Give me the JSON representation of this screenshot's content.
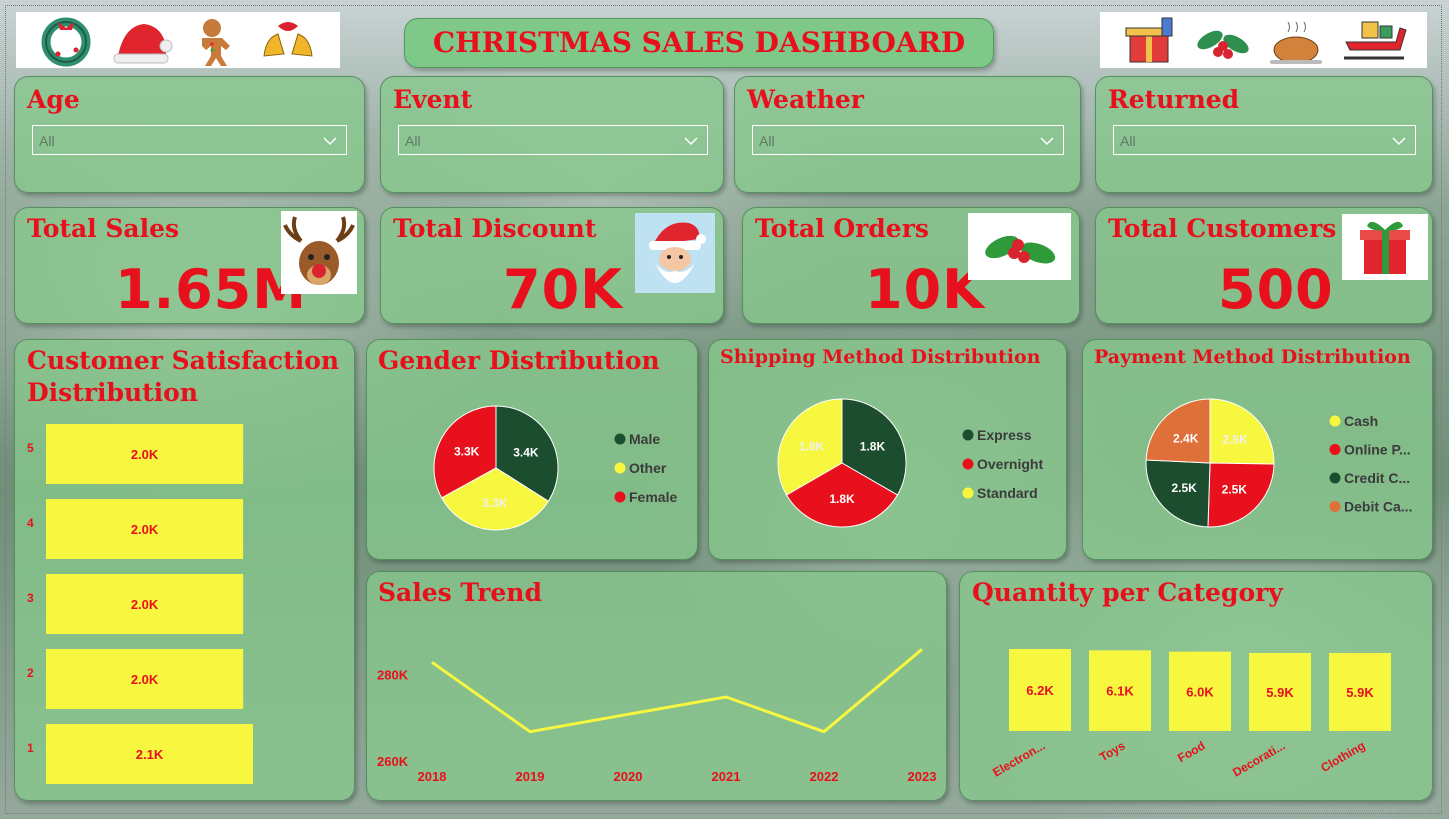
{
  "header": {
    "title": "CHRISTMAS SALES DASHBOARD"
  },
  "icons_left": [
    "wreath-icon",
    "santa-hat-icon",
    "gingerbread-icon",
    "bells-icon"
  ],
  "icons_right": [
    "gift-icon",
    "holly-icon",
    "roast-turkey-icon",
    "sleigh-icon"
  ],
  "filters": [
    {
      "label": "Age",
      "value": "All"
    },
    {
      "label": "Event",
      "value": "All"
    },
    {
      "label": "Weather",
      "value": "All"
    },
    {
      "label": "Returned",
      "value": "All"
    }
  ],
  "kpis": [
    {
      "label": "Total Sales",
      "value": "1.65M",
      "icon": "reindeer-icon"
    },
    {
      "label": "Total Discount",
      "value": "70K",
      "icon": "santa-icon"
    },
    {
      "label": "Total Orders",
      "value": "10K",
      "icon": "holly-icon"
    },
    {
      "label": "Total Customers",
      "value": "500",
      "icon": "gift-icon"
    }
  ],
  "colors": {
    "red": "#e8101c",
    "green": "#1b4d2e",
    "yellow": "#f7f740",
    "orange": "#e0703a",
    "card": "#87c88c"
  },
  "satisfaction": {
    "title_line1": "Customer Satisfaction",
    "title_line2": "Distribution"
  },
  "gender": {
    "title": "Gender Distribution"
  },
  "shipping": {
    "title": "Shipping Method Distribution"
  },
  "payment": {
    "title": "Payment Method Distribution"
  },
  "trend": {
    "title": "Sales Trend"
  },
  "category": {
    "title": "Quantity per Category"
  },
  "chart_data": [
    {
      "type": "bar",
      "orientation": "horizontal",
      "categories": [
        "5",
        "4",
        "3",
        "2",
        "1"
      ],
      "values": [
        2.0,
        2.0,
        2.0,
        2.0,
        2.1
      ],
      "labels": [
        "2.0K",
        "2.0K",
        "2.0K",
        "2.0K",
        "2.1K"
      ],
      "title": "Customer Satisfaction Distribution",
      "color": "#f7f740"
    },
    {
      "type": "pie",
      "title": "Gender Distribution",
      "series": [
        {
          "name": "Male",
          "value": 3.4,
          "label": "3.4K",
          "color": "#1b4d2e"
        },
        {
          "name": "Other",
          "value": 3.3,
          "label": "3.3K",
          "color": "#f7f740"
        },
        {
          "name": "Female",
          "value": 3.3,
          "label": "3.3K",
          "color": "#e8101c"
        }
      ],
      "legend": "right"
    },
    {
      "type": "pie",
      "title": "Shipping Method Distribution",
      "series": [
        {
          "name": "Express",
          "value": 1.8,
          "label": "1.8K",
          "color": "#1b4d2e"
        },
        {
          "name": "Overnight",
          "value": 1.8,
          "label": "1.8K",
          "color": "#e8101c"
        },
        {
          "name": "Standard",
          "value": 1.8,
          "label": "1.8K",
          "color": "#f7f740"
        }
      ],
      "legend": "right"
    },
    {
      "type": "pie",
      "title": "Payment Method Distribution",
      "series": [
        {
          "name": "Cash",
          "value": 2.5,
          "label": "2.5K",
          "color": "#f7f740"
        },
        {
          "name": "Online P...",
          "value": 2.5,
          "label": "2.5K",
          "color": "#e8101c"
        },
        {
          "name": "Credit C...",
          "value": 2.5,
          "label": "2.5K",
          "color": "#1b4d2e"
        },
        {
          "name": "Debit Ca...",
          "value": 2.4,
          "label": "2.4K",
          "color": "#e0703a"
        }
      ],
      "legend": "right"
    },
    {
      "type": "line",
      "title": "Sales Trend",
      "x": [
        "2018",
        "2019",
        "2020",
        "2021",
        "2022",
        "2023"
      ],
      "values": [
        283,
        267,
        271,
        275,
        267,
        286
      ],
      "ylim": [
        260,
        290
      ],
      "yticks": [
        "260K",
        "280K"
      ],
      "ytick_values": [
        260,
        280
      ],
      "color": "#f7f740"
    },
    {
      "type": "bar",
      "title": "Quantity per Category",
      "categories": [
        "Electron...",
        "Toys",
        "Food",
        "Decorati...",
        "Clothing"
      ],
      "values": [
        6.2,
        6.1,
        6.0,
        5.9,
        5.9
      ],
      "labels": [
        "6.2K",
        "6.1K",
        "6.0K",
        "5.9K",
        "5.9K"
      ],
      "color": "#f7f740"
    }
  ]
}
